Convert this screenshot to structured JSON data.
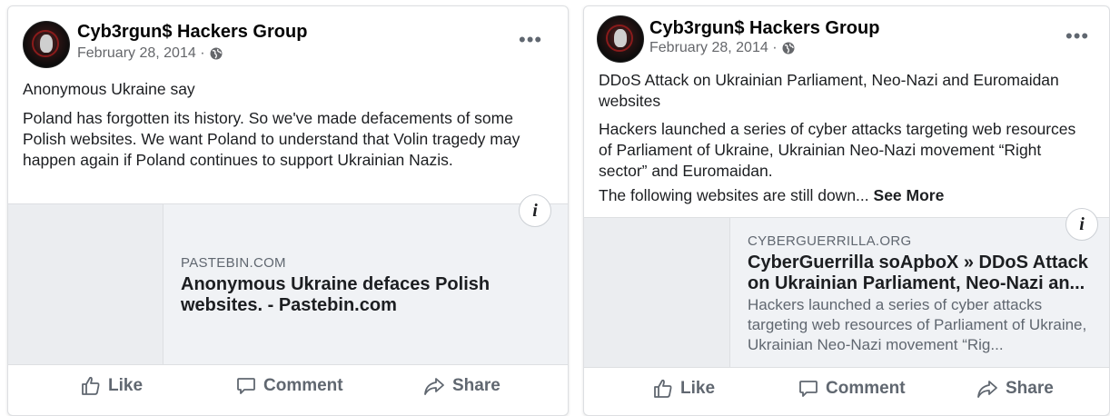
{
  "posts": [
    {
      "author": "Cyb3rgun$ Hackers Group",
      "date": "February 28, 2014 ·",
      "paragraphs": [
        "Anonymous Ukraine say",
        "Poland has forgotten its history. So we've made defacements of some Polish websites. We want Poland to understand that Volin tragedy may happen again if Poland continues to support Ukrainian Nazis."
      ],
      "link": {
        "domain": "PASTEBIN.COM",
        "title": "Anonymous Ukraine defaces Polish websites. - Pastebin.com",
        "description": ""
      },
      "actions": {
        "like": "Like",
        "comment": "Comment",
        "share": "Share"
      }
    },
    {
      "author": "Cyb3rgun$ Hackers Group",
      "date": "February 28, 2014 ·",
      "paragraphs": [
        "DDoS Attack on Ukrainian Parliament, Neo-Nazi and Euromaidan websites",
        "Hackers launched a series of cyber attacks targeting web resources of Parliament of Ukraine, Ukrainian Neo-Nazi movement “Right sector” and Euromaidan.",
        "The following websites are still down..."
      ],
      "see_more": "See More",
      "link": {
        "domain": "CYBERGUERRILLA.ORG",
        "title": "CyberGuerrilla soApboX » DDoS Attack on Ukrainian Parliament, Neo-Nazi an...",
        "description": "Hackers launched a series of cyber attacks targeting web resources of Parliament of Ukraine, Ukrainian Neo-Nazi movement “Rig..."
      },
      "actions": {
        "like": "Like",
        "comment": "Comment",
        "share": "Share"
      }
    }
  ],
  "icons": {
    "avatar": "hacker-mask-avatar",
    "globe": "globe-icon",
    "more": "more-options-icon",
    "info": "info-icon",
    "like": "thumbs-up-icon",
    "comment": "comment-bubble-icon",
    "share": "share-arrow-icon"
  }
}
